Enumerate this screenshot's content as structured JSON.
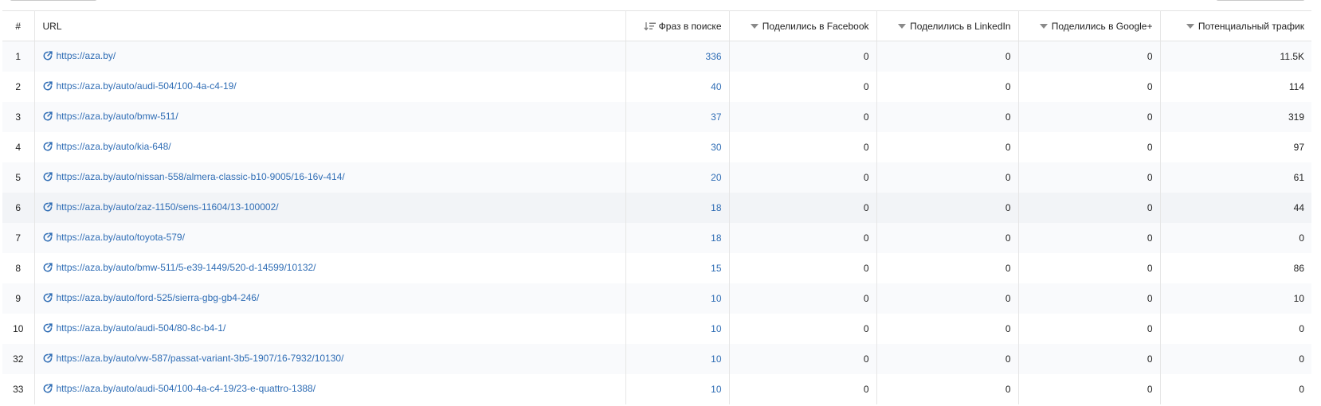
{
  "table": {
    "headers": {
      "num": "#",
      "url": "URL",
      "phrases": "Фраз в поиске",
      "facebook": "Поделились в Facebook",
      "linkedin": "Поделились в LinkedIn",
      "google": "Поделились в Google+",
      "traffic": "Потенциальный трафик"
    },
    "rows": [
      {
        "num": "1",
        "url": "https://aza.by/",
        "phrases": "336",
        "facebook": "0",
        "linkedin": "0",
        "google": "0",
        "traffic": "11.5K"
      },
      {
        "num": "2",
        "url": "https://aza.by/auto/audi-504/100-4a-c4-19/",
        "phrases": "40",
        "facebook": "0",
        "linkedin": "0",
        "google": "0",
        "traffic": "114"
      },
      {
        "num": "3",
        "url": "https://aza.by/auto/bmw-511/",
        "phrases": "37",
        "facebook": "0",
        "linkedin": "0",
        "google": "0",
        "traffic": "319"
      },
      {
        "num": "4",
        "url": "https://aza.by/auto/kia-648/",
        "phrases": "30",
        "facebook": "0",
        "linkedin": "0",
        "google": "0",
        "traffic": "97"
      },
      {
        "num": "5",
        "url": "https://aza.by/auto/nissan-558/almera-classic-b10-9005/16-16v-414/",
        "phrases": "20",
        "facebook": "0",
        "linkedin": "0",
        "google": "0",
        "traffic": "61"
      },
      {
        "num": "6",
        "url": "https://aza.by/auto/zaz-1150/sens-11604/13-100002/",
        "phrases": "18",
        "facebook": "0",
        "linkedin": "0",
        "google": "0",
        "traffic": "44"
      },
      {
        "num": "7",
        "url": "https://aza.by/auto/toyota-579/",
        "phrases": "18",
        "facebook": "0",
        "linkedin": "0",
        "google": "0",
        "traffic": "0"
      },
      {
        "num": "8",
        "url": "https://aza.by/auto/bmw-511/5-e39-1449/520-d-14599/10132/",
        "phrases": "15",
        "facebook": "0",
        "linkedin": "0",
        "google": "0",
        "traffic": "86"
      },
      {
        "num": "9",
        "url": "https://aza.by/auto/ford-525/sierra-gbg-gb4-246/",
        "phrases": "10",
        "facebook": "0",
        "linkedin": "0",
        "google": "0",
        "traffic": "10"
      },
      {
        "num": "10",
        "url": "https://aza.by/auto/audi-504/80-8c-b4-1/",
        "phrases": "10",
        "facebook": "0",
        "linkedin": "0",
        "google": "0",
        "traffic": "0"
      },
      {
        "num": "32",
        "url": "https://aza.by/auto/vw-587/passat-variant-3b5-1907/16-7932/10130/",
        "phrases": "10",
        "facebook": "0",
        "linkedin": "0",
        "google": "0",
        "traffic": "0"
      },
      {
        "num": "33",
        "url": "https://aza.by/auto/audi-504/100-4a-c4-19/23-e-quattro-1388/",
        "phrases": "10",
        "facebook": "0",
        "linkedin": "0",
        "google": "0",
        "traffic": "0"
      }
    ]
  },
  "icons": {
    "external_link": "external-link-icon",
    "sort_active": "sort-descending-icon",
    "sort_inactive": "sort-caret-icon"
  },
  "colors": {
    "link": "#2f6db5",
    "row_alt": "#f9fafc",
    "row_hover": "#f2f4f7",
    "border": "#e3e3e3"
  }
}
